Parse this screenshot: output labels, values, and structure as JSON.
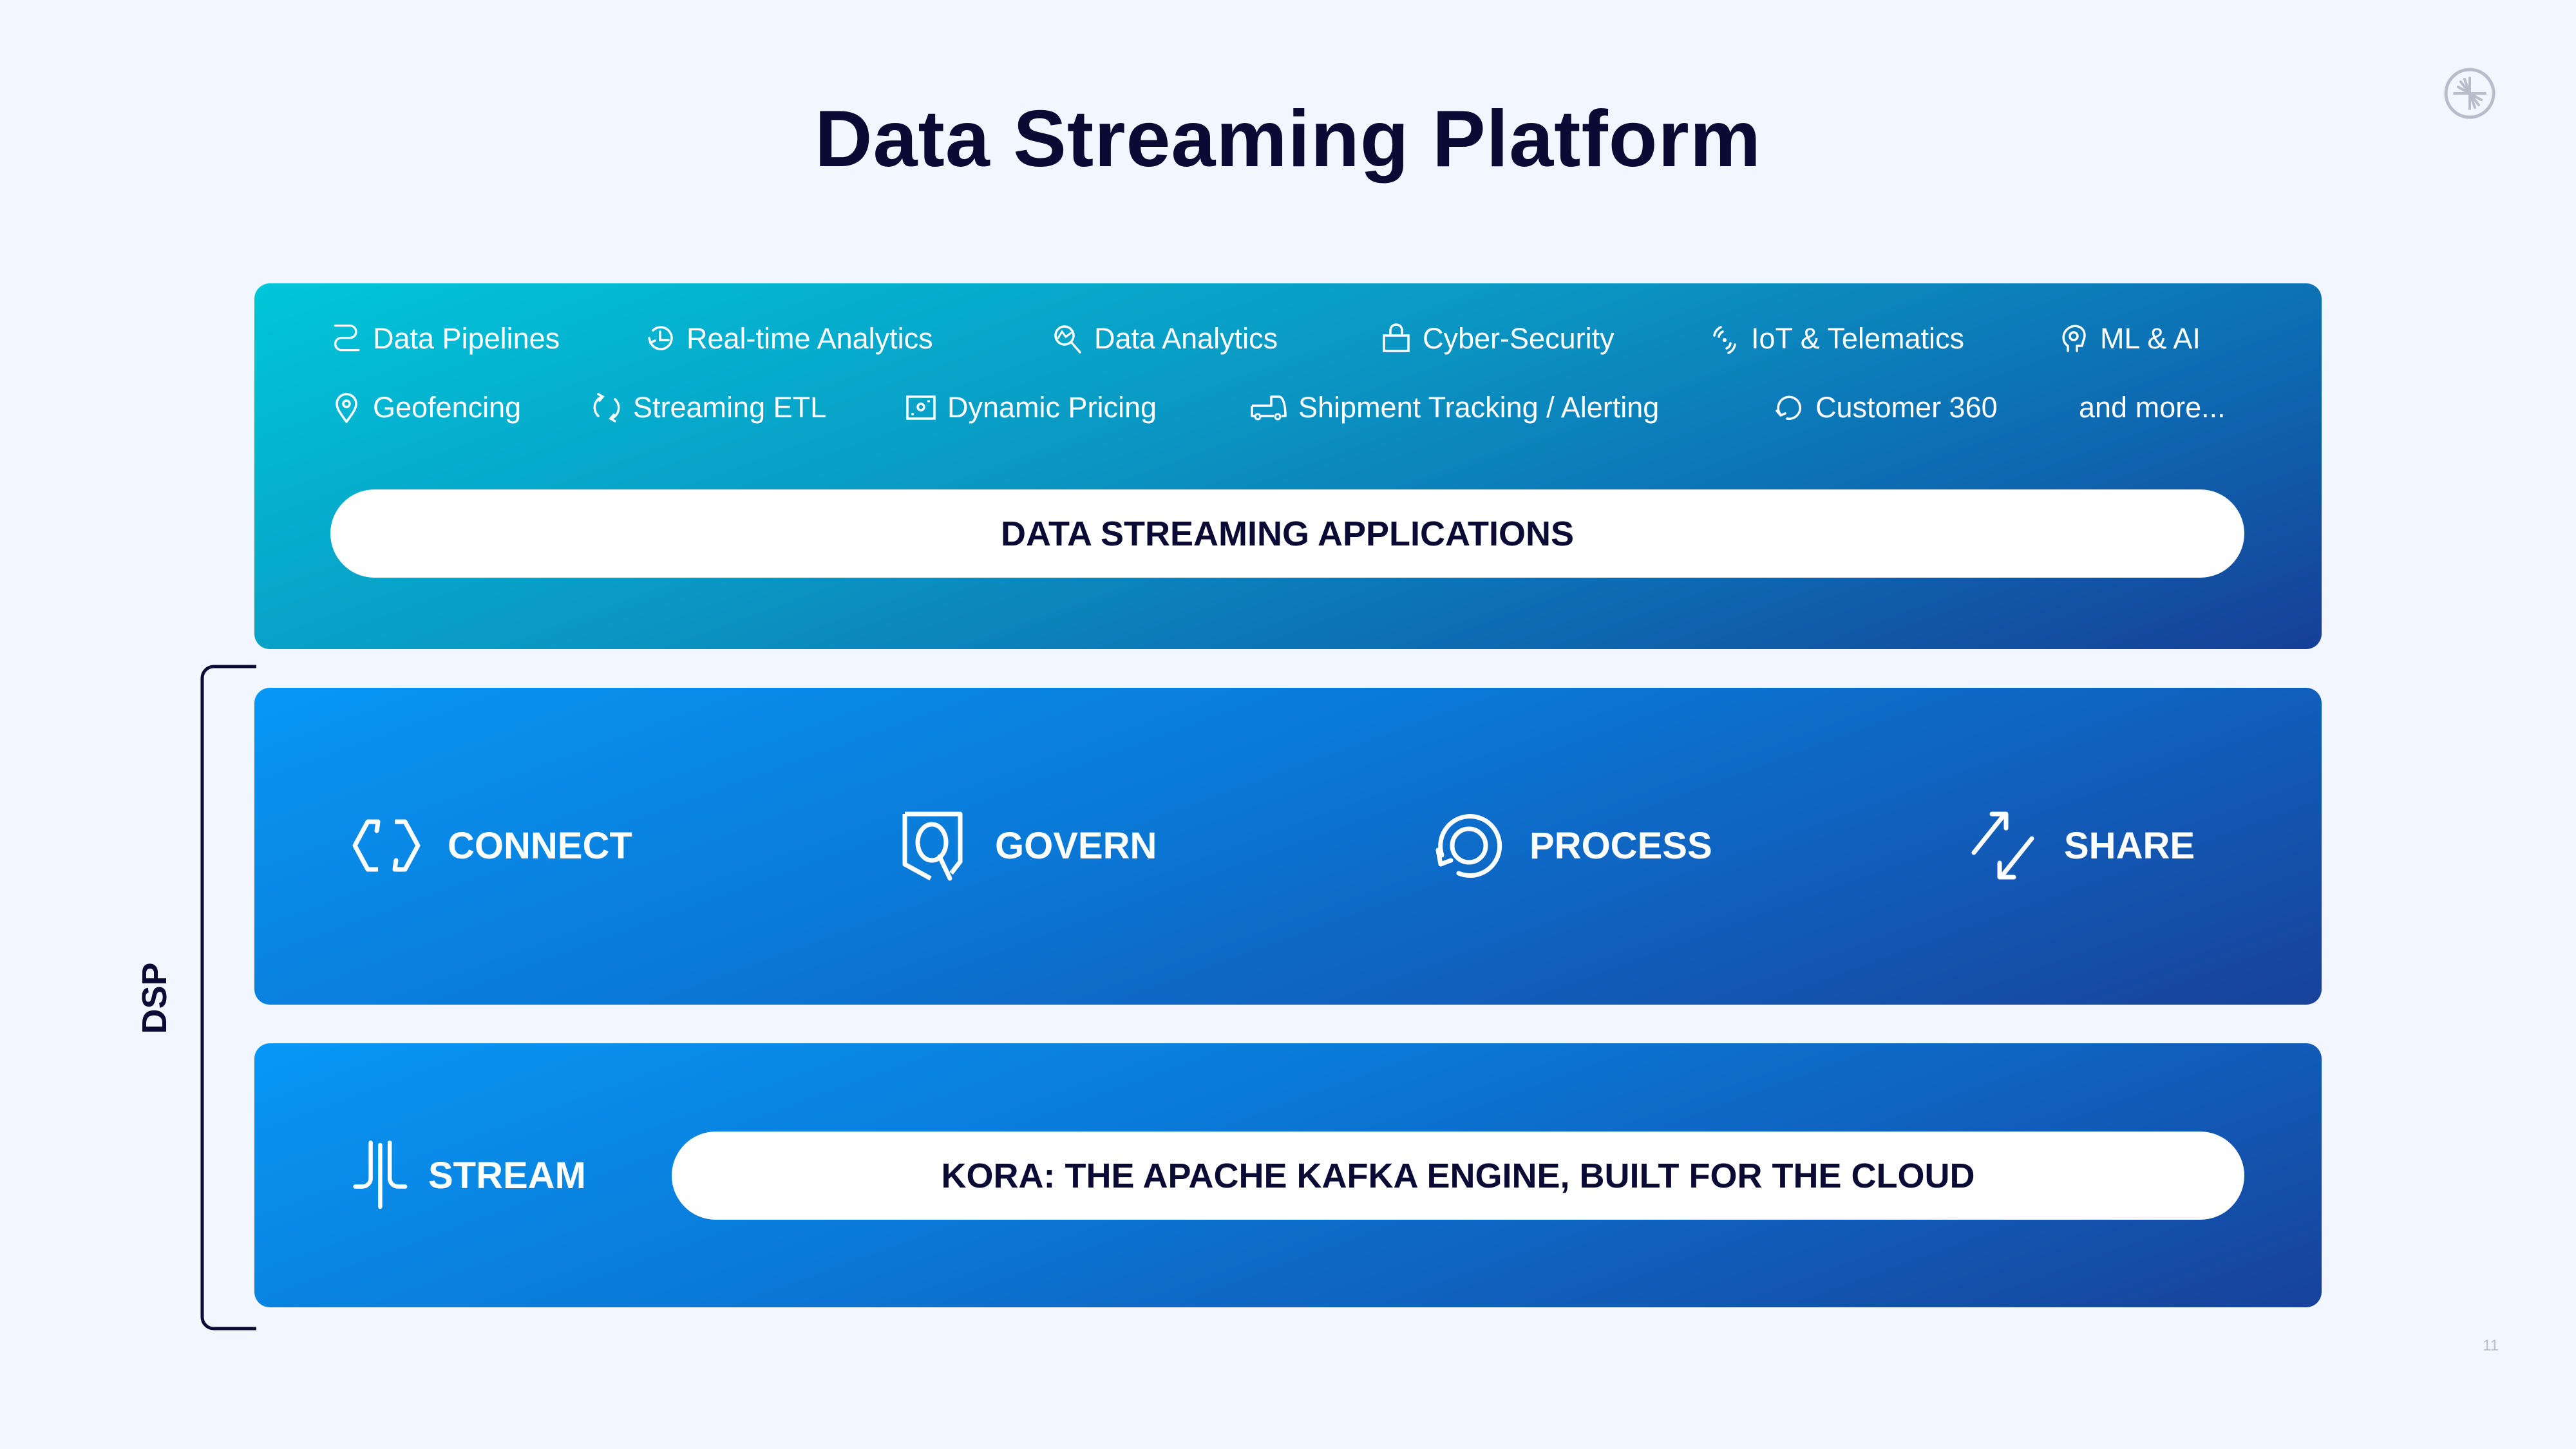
{
  "title": "Data Streaming Platform",
  "page_number": "11",
  "logo": {
    "icon": "confluent-logo-icon"
  },
  "applications": {
    "row1": [
      {
        "label": "Data Pipelines",
        "icon": "pipeline-icon"
      },
      {
        "label": "Real-time Analytics",
        "icon": "clock-refresh-icon"
      },
      {
        "label": "Data Analytics",
        "icon": "magnifier-chart-icon"
      },
      {
        "label": "Cyber-Security",
        "icon": "lock-icon"
      },
      {
        "label": "IoT & Telematics",
        "icon": "signal-icon"
      },
      {
        "label": "ML & AI",
        "icon": "head-icon"
      }
    ],
    "row2": [
      {
        "label": "Geofencing",
        "icon": "map-pin-icon"
      },
      {
        "label": "Streaming ETL",
        "icon": "cycle-arrows-icon"
      },
      {
        "label": "Dynamic Pricing",
        "icon": "price-tag-icon"
      },
      {
        "label": "Shipment Tracking / Alerting",
        "icon": "truck-icon"
      },
      {
        "label": "Customer 360",
        "icon": "circle-arrow-icon"
      },
      {
        "label": "and more...",
        "icon": ""
      }
    ],
    "banner": "DATA STREAMING APPLICATIONS"
  },
  "capabilities": [
    {
      "label": "CONNECT",
      "icon": "hexagon-connect-icon"
    },
    {
      "label": "GOVERN",
      "icon": "shield-search-icon"
    },
    {
      "label": "PROCESS",
      "icon": "process-cycle-icon"
    },
    {
      "label": "SHARE",
      "icon": "share-arrows-icon"
    }
  ],
  "stream": {
    "label": "STREAM",
    "icon": "stream-lines-icon",
    "banner": "KORA: THE APACHE KAFKA ENGINE, BUILT FOR THE CLOUD"
  },
  "bracket_label": "DSP",
  "colors": {
    "title": "#0a0a35",
    "background": "#f2f6fe",
    "apps_gradient_start": "#00c6d9",
    "apps_gradient_end": "#163f98",
    "dsp_gradient_start": "#0897f5",
    "dsp_gradient_end": "#17429a"
  }
}
